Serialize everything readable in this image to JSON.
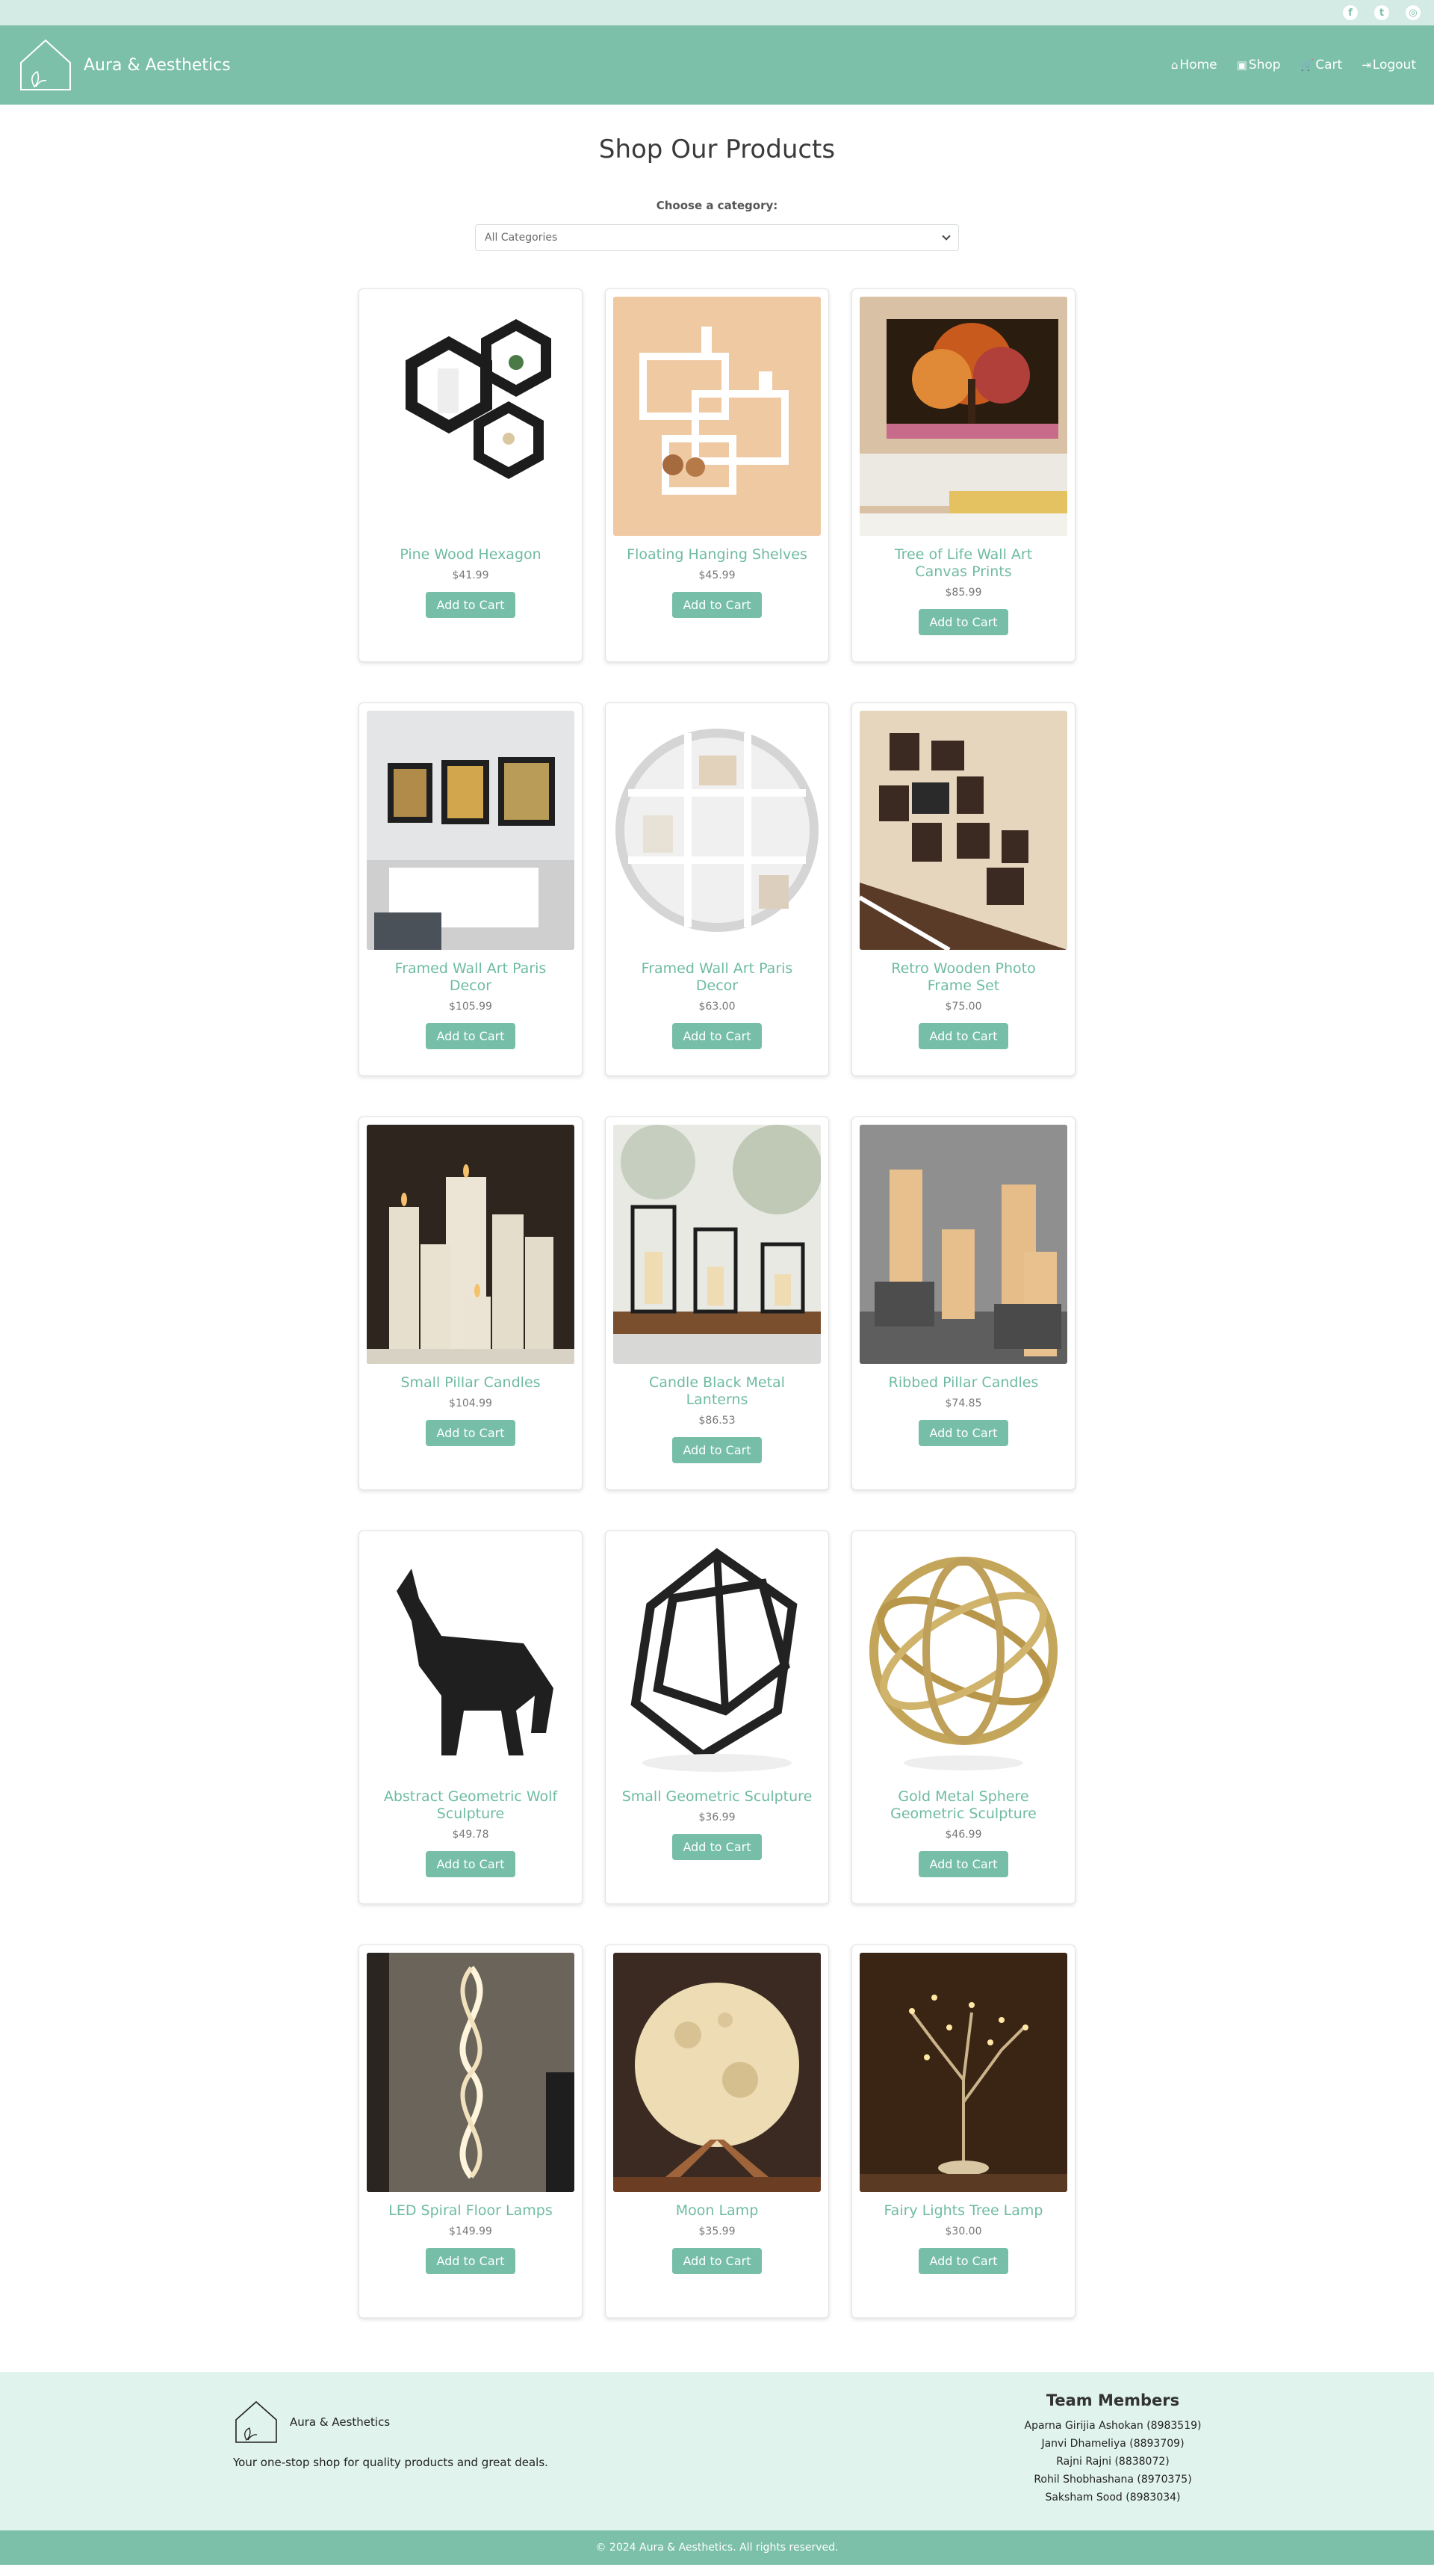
{
  "social": {
    "facebook_icon": "f",
    "twitter_icon": "t",
    "instagram_icon": "◎"
  },
  "navbar": {
    "brand": "Aura & Aesthetics",
    "links": {
      "home": "Home",
      "shop": "Shop",
      "cart": "Cart",
      "logout": "Logout"
    }
  },
  "page": {
    "title": "Shop Our Products"
  },
  "filter": {
    "label": "Choose a category:",
    "selected": "All Categories"
  },
  "products": [
    {
      "name": "Pine Wood Hexagon",
      "price": "$41.99",
      "button": "Add to Cart",
      "icon": "hexagon-shelf-icon"
    },
    {
      "name": "Floating Hanging Shelves",
      "price": "$45.99",
      "button": "Add to Cart",
      "icon": "floating-shelf-icon"
    },
    {
      "name": "Tree of Life Wall Art Canvas Prints",
      "price": "$85.99",
      "button": "Add to Cart",
      "icon": "tree-canvas-icon"
    },
    {
      "name": "Framed Wall Art Paris Decor",
      "price": "$105.99",
      "button": "Add to Cart",
      "icon": "framed-art-icon"
    },
    {
      "name": "Framed Wall Art Paris Decor",
      "price": "$63.00",
      "button": "Add to Cart",
      "icon": "round-shelf-icon"
    },
    {
      "name": "Retro Wooden Photo Frame Set",
      "price": "$75.00",
      "button": "Add to Cart",
      "icon": "photo-frames-icon"
    },
    {
      "name": "Small Pillar Candles",
      "price": "$104.99",
      "button": "Add to Cart",
      "icon": "pillar-candles-icon"
    },
    {
      "name": "Candle Black Metal Lanterns",
      "price": "$86.53",
      "button": "Add to Cart",
      "icon": "lanterns-icon"
    },
    {
      "name": "Ribbed Pillar Candles",
      "price": "$74.85",
      "button": "Add to Cart",
      "icon": "ribbed-candles-icon"
    },
    {
      "name": "Abstract Geometric Wolf Sculpture",
      "price": "$49.78",
      "button": "Add to Cart",
      "icon": "wolf-sculpture-icon"
    },
    {
      "name": "Small Geometric Sculpture",
      "price": "$36.99",
      "button": "Add to Cart",
      "icon": "geometric-cube-icon"
    },
    {
      "name": "Gold Metal Sphere Geometric Sculpture",
      "price": "$46.99",
      "button": "Add to Cart",
      "icon": "gold-sphere-icon"
    },
    {
      "name": "LED Spiral Floor Lamps",
      "price": "$149.99",
      "button": "Add to Cart",
      "icon": "spiral-lamp-icon"
    },
    {
      "name": "Moon Lamp",
      "price": "$35.99",
      "button": "Add to Cart",
      "icon": "moon-lamp-icon"
    },
    {
      "name": "Fairy Lights Tree Lamp",
      "price": "$30.00",
      "button": "Add to Cart",
      "icon": "tree-lamp-icon"
    }
  ],
  "footer": {
    "brand": "Aura & Aesthetics",
    "tagline": "Your one-stop shop for quality products and great deals.",
    "team_title": "Team Members",
    "team": [
      "Aparna Girijia Ashokan (8983519)",
      "Janvi Dhameliya (8893709)",
      "Rajni Rajni (8838072)",
      "Rohil Shobhashana (8970375)",
      "Saksham Sood (8983034)"
    ],
    "copyright": "© 2024 Aura & Aesthetics. All rights reserved."
  },
  "colors": {
    "primary": "#7cc0aa",
    "light": "#e0f3ec",
    "accent_text": "#6fbba3"
  }
}
